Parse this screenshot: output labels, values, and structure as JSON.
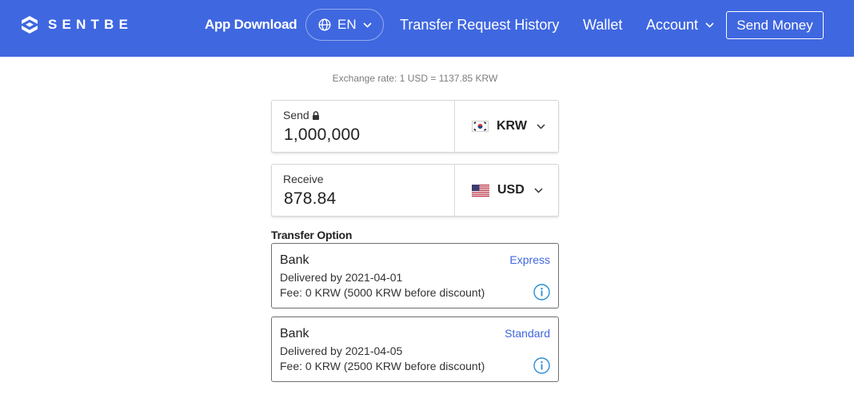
{
  "header": {
    "logo_text": "SENTBE",
    "app_download": "App Download",
    "language": "EN",
    "nav_history": "Transfer Request History",
    "nav_wallet": "Wallet",
    "nav_account": "Account",
    "send_money": "Send Money"
  },
  "main": {
    "exchange_rate": "Exchange rate: 1 USD = 1137.85 KRW",
    "send": {
      "label": "Send",
      "value": "1,000,000",
      "currency": "KRW",
      "locked": true
    },
    "receive": {
      "label": "Receive",
      "value": "878.84",
      "currency": "USD"
    },
    "transfer_option_title": "Transfer Option",
    "options": [
      {
        "title": "Bank",
        "speed": "Express",
        "delivered": "Delivered by 2021-04-01",
        "fee": "Fee: 0 KRW (5000 KRW before discount)"
      },
      {
        "title": "Bank",
        "speed": "Standard",
        "delivered": "Delivered by 2021-04-05",
        "fee": "Fee: 0 KRW (2500 KRW before discount)"
      }
    ]
  },
  "icons": {
    "logo": "sentbe-logo-icon",
    "globe": "globe-icon",
    "chevron": "chevron-down-icon",
    "lock": "lock-icon",
    "flag_kr": "south-korea-flag-icon",
    "flag_us": "us-flag-icon",
    "info": "info-icon"
  },
  "colors": {
    "brand_blue": "#3f67e0",
    "accent_text_blue": "#3f67e0",
    "info_blue": "#2a8fd4"
  }
}
